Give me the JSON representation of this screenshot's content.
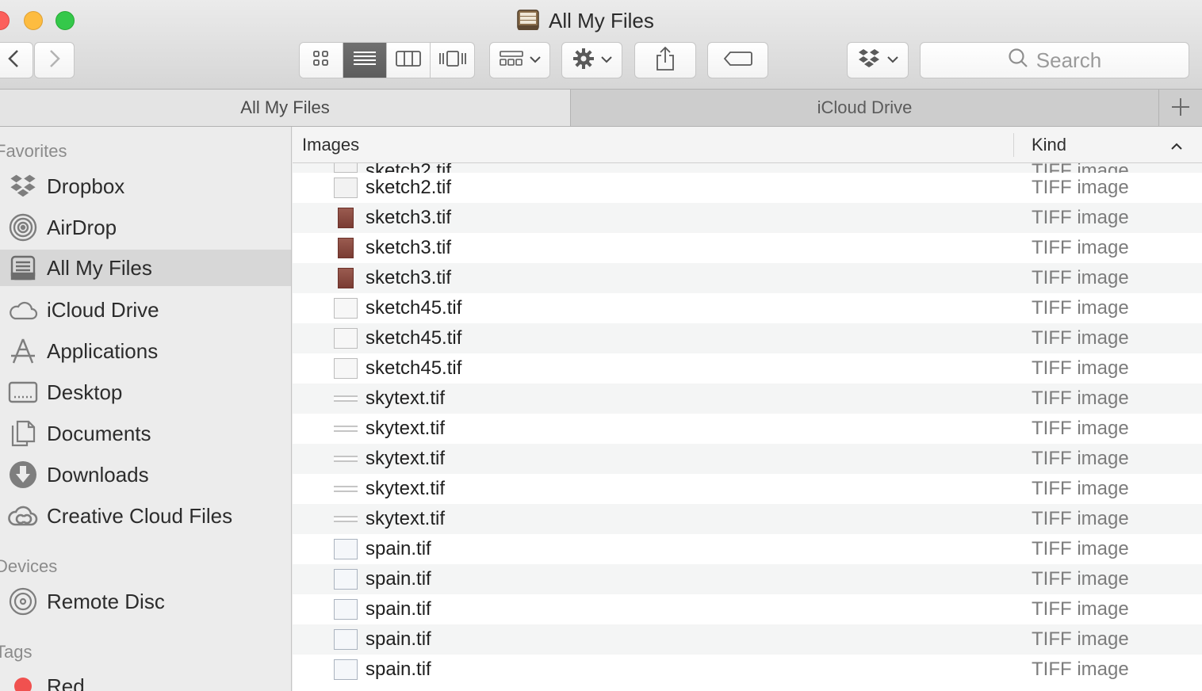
{
  "window": {
    "title": "All My Files"
  },
  "toolbar": {
    "back_icon": "chevron-left-icon",
    "forward_icon": "chevron-right-icon",
    "view_modes": [
      "icon-view",
      "list-view",
      "column-view",
      "cover-flow-view"
    ],
    "active_view": "list-view",
    "search_placeholder": "Search"
  },
  "tabs": [
    {
      "label": "All My Files",
      "active": true
    },
    {
      "label": "iCloud Drive",
      "active": false
    }
  ],
  "sidebar": {
    "favorites_header": "Favorites",
    "favorites": [
      {
        "label": "Dropbox",
        "icon": "dropbox-icon"
      },
      {
        "label": "AirDrop",
        "icon": "airdrop-icon"
      },
      {
        "label": "All My Files",
        "icon": "all-my-files-icon",
        "selected": true
      },
      {
        "label": "iCloud Drive",
        "icon": "cloud-icon"
      },
      {
        "label": "Applications",
        "icon": "applications-icon"
      },
      {
        "label": "Desktop",
        "icon": "desktop-icon"
      },
      {
        "label": "Documents",
        "icon": "documents-icon"
      },
      {
        "label": "Downloads",
        "icon": "downloads-icon"
      },
      {
        "label": "Creative Cloud Files",
        "icon": "creative-cloud-icon"
      }
    ],
    "devices_header": "Devices",
    "devices": [
      {
        "label": "Remote Disc",
        "icon": "disc-icon"
      }
    ],
    "tags_header": "Tags",
    "tags": [
      {
        "label": "Red",
        "color": "#f0514f"
      }
    ]
  },
  "list": {
    "group_header": "Images",
    "kind_header": "Kind",
    "files": [
      {
        "name": "sketch2.tif",
        "kind": "TIFF image",
        "thumb": "sketch2"
      },
      {
        "name": "sketch3.tif",
        "kind": "TIFF image",
        "thumb": "sketch3"
      },
      {
        "name": "sketch3.tif",
        "kind": "TIFF image",
        "thumb": "sketch3"
      },
      {
        "name": "sketch3.tif",
        "kind": "TIFF image",
        "thumb": "sketch3"
      },
      {
        "name": "sketch45.tif",
        "kind": "TIFF image",
        "thumb": "sketch45"
      },
      {
        "name": "sketch45.tif",
        "kind": "TIFF image",
        "thumb": "sketch45"
      },
      {
        "name": "sketch45.tif",
        "kind": "TIFF image",
        "thumb": "sketch45"
      },
      {
        "name": "skytext.tif",
        "kind": "TIFF image",
        "thumb": "skytext"
      },
      {
        "name": "skytext.tif",
        "kind": "TIFF image",
        "thumb": "skytext"
      },
      {
        "name": "skytext.tif",
        "kind": "TIFF image",
        "thumb": "skytext"
      },
      {
        "name": "skytext.tif",
        "kind": "TIFF image",
        "thumb": "skytext"
      },
      {
        "name": "skytext.tif",
        "kind": "TIFF image",
        "thumb": "skytext"
      },
      {
        "name": "spain.tif",
        "kind": "TIFF image",
        "thumb": "spain"
      },
      {
        "name": "spain.tif",
        "kind": "TIFF image",
        "thumb": "spain"
      },
      {
        "name": "spain.tif",
        "kind": "TIFF image",
        "thumb": "spain"
      },
      {
        "name": "spain.tif",
        "kind": "TIFF image",
        "thumb": "spain"
      },
      {
        "name": "spain.tif",
        "kind": "TIFF image",
        "thumb": "spain"
      }
    ]
  }
}
